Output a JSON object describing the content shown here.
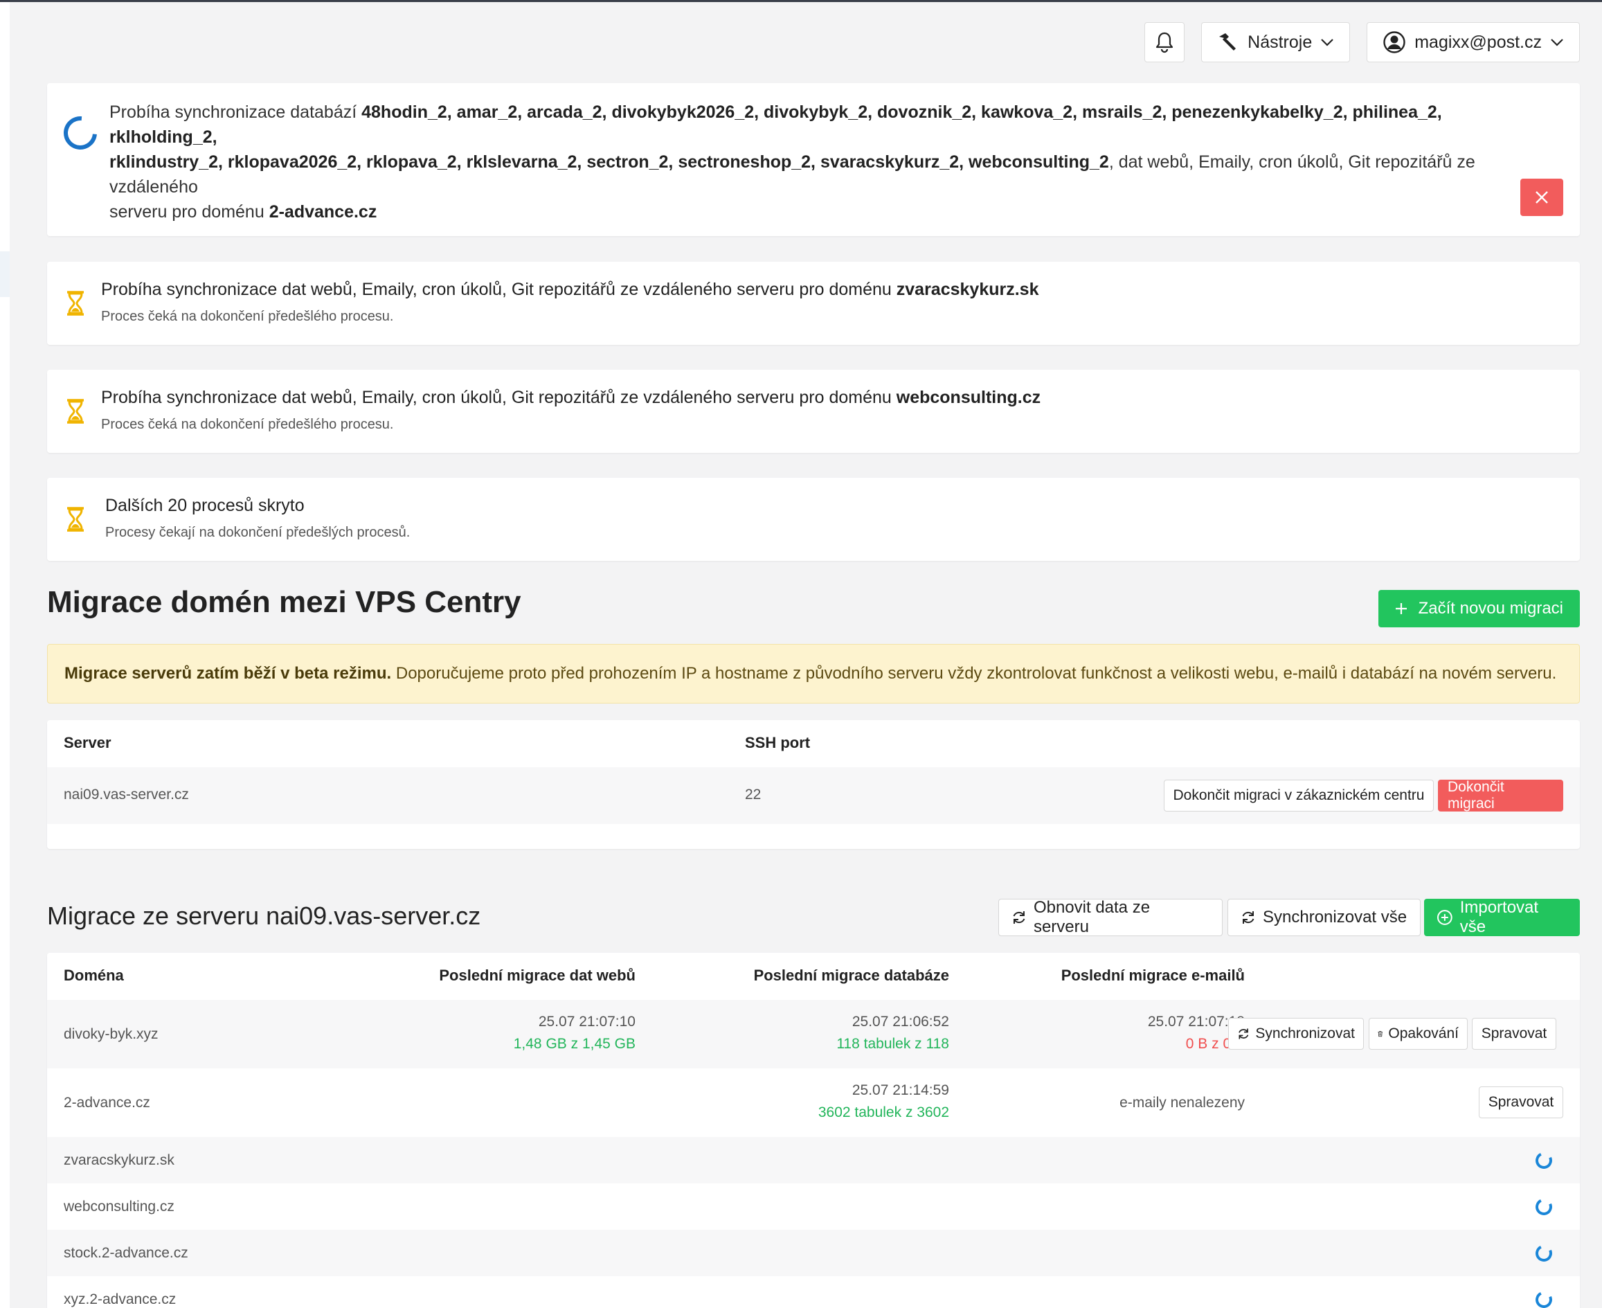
{
  "header": {
    "tools_label": "Nástroje",
    "user_label": "magixx@post.cz"
  },
  "sync_notice": {
    "prefix": "Probíha synchronizace databází ",
    "databases": "48hodin_2, amar_2, arcada_2, divokybyk2026_2, divokybyk_2, dovoznik_2, kawkova_2, msrails_2, penezenkykabelky_2, philinea_2, rklholding_2,",
    "databases2": "rklindustry_2, rklopava2026_2, rklopava_2, rklslevarna_2, sectron_2, sectroneshop_2, svaracskykurz_2, webconsulting_2",
    "suffix": ", dat webů, Emaily, cron úkolů, Git repozitářů ze vzdáleného",
    "line3_prefix": "serveru pro doménu ",
    "domain": "2-advance.cz"
  },
  "waiting": [
    {
      "title_prefix": "Probíha synchronizace dat webů, Emaily, cron úkolů, Git repozitářů ze vzdáleného serveru pro doménu ",
      "domain": "zvaracskykurz.sk",
      "sub": "Proces čeká na dokončení předešlého procesu."
    },
    {
      "title_prefix": "Probíha synchronizace dat webů, Emaily, cron úkolů, Git repozitářů ze vzdáleného serveru pro doménu ",
      "domain": "webconsulting.cz",
      "sub": "Proces čeká na dokončení předešlého procesu."
    },
    {
      "title": "Dalších 20 procesů skryto",
      "sub": "Procesy čekají na dokončení předešlých procesů."
    }
  ],
  "section": {
    "title": "Migrace domén mezi VPS Centry",
    "new_button": "Začít novou migraci",
    "beta_bold": "Migrace serverů zatím běží v beta režimu.",
    "beta_text": " Doporučujeme proto před prohozením IP a hostname z původního serveru vždy zkontrolovat funkčnost a velikosti webu, e-mailů i databází na novém serveru."
  },
  "server_table": {
    "col_server": "Server",
    "col_port": "SSH port",
    "server": "nai09.vas-server.cz",
    "port": "22",
    "btn_finish_center": "Dokončit migraci v zákaznickém centru",
    "btn_finish": "Dokončit migraci"
  },
  "migration": {
    "title": "Migrace ze serveru nai09.vas-server.cz",
    "btn_refresh": "Obnovit data ze serveru",
    "btn_sync_all": "Synchronizovat vše",
    "btn_import_all": "Importovat vše",
    "cols": {
      "domain": "Doména",
      "web": "Poslední migrace dat webů",
      "db": "Poslední migrace databáze",
      "mail": "Poslední migrace e-mailů"
    },
    "rows": [
      {
        "domain": "divoky-byk.xyz",
        "web_time": "25.07 21:07:10",
        "web_size": "1,48 GB z 1,45 GB",
        "db_time": "25.07 21:06:52",
        "db_count": "118 tabulek z 118",
        "mail_time": "25.07 21:07:18",
        "mail_size": "0 B z 0 B",
        "btn_sync": "Synchronizovat",
        "btn_retry": "Opakování",
        "btn_manage": "Spravovat"
      },
      {
        "domain": "2-advance.cz",
        "db_time": "25.07 21:14:59",
        "db_count": "3602 tabulek z 3602",
        "mail_status": "e-maily nenalezeny",
        "btn_manage": "Spravovat"
      },
      {
        "domain": "zvaracskykurz.sk"
      },
      {
        "domain": "webconsulting.cz"
      },
      {
        "domain": "stock.2-advance.cz"
      },
      {
        "domain": "xyz.2-advance.cz"
      }
    ]
  }
}
